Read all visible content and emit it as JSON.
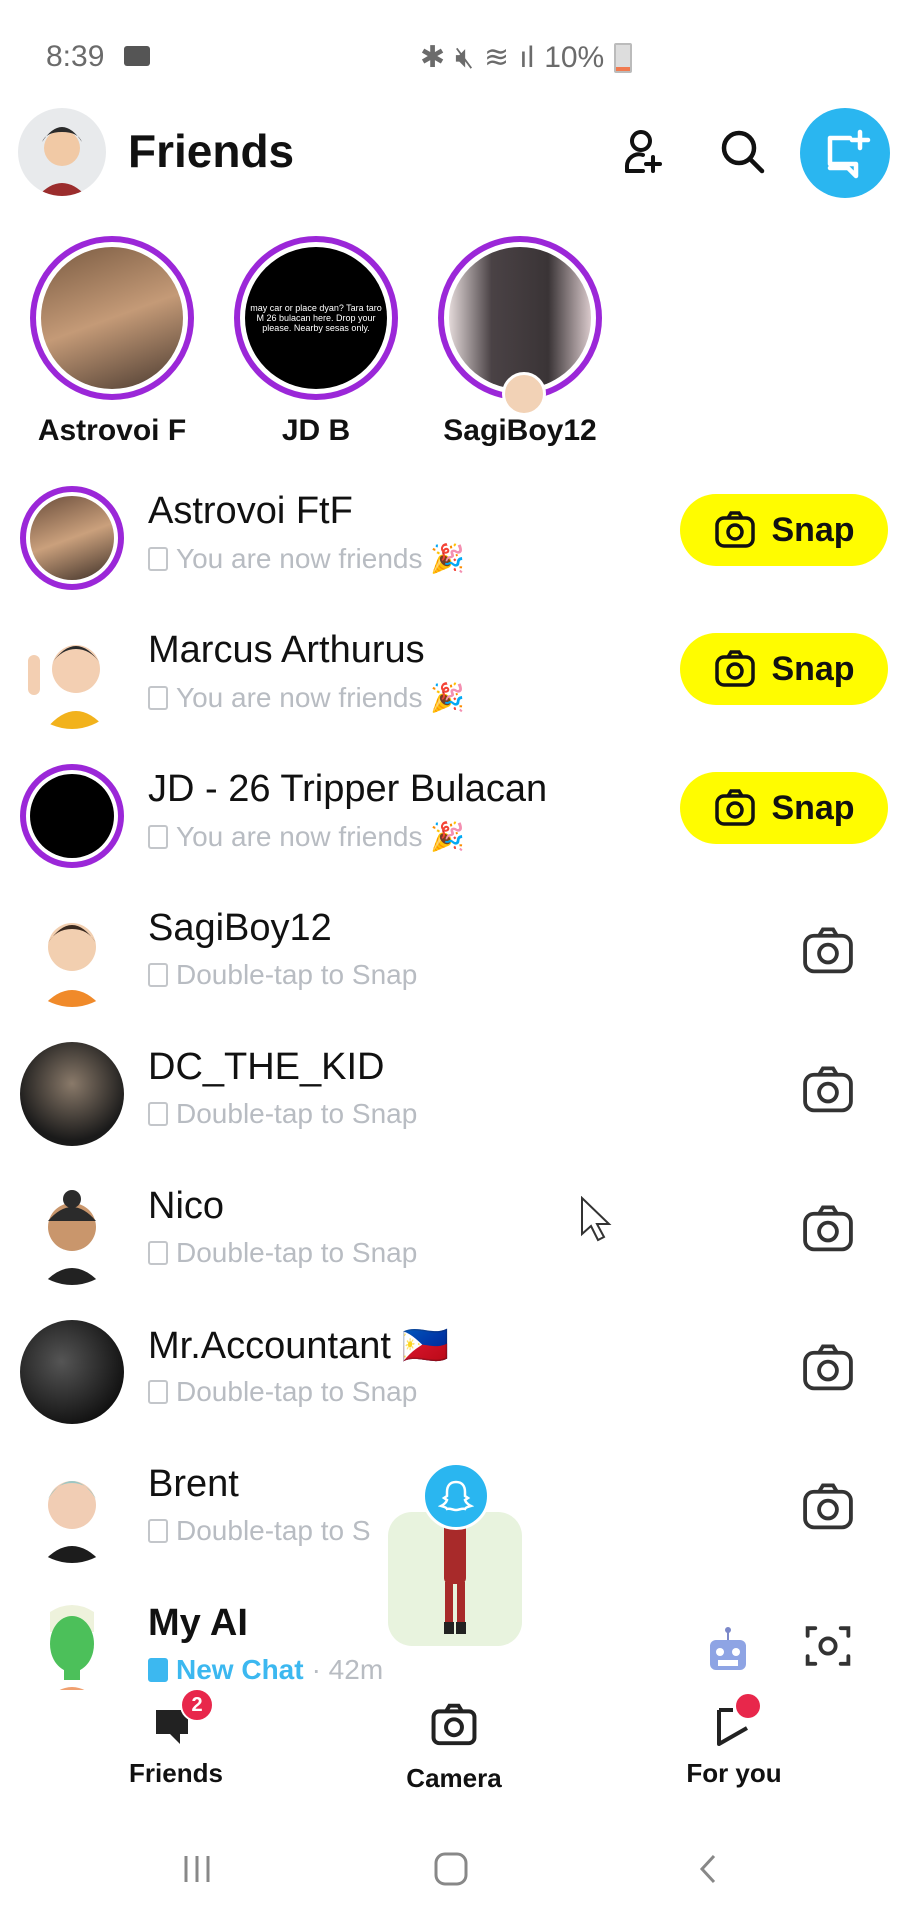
{
  "status_bar": {
    "time": "8:39",
    "battery": "10%"
  },
  "header": {
    "title": "Friends",
    "add_friend_icon": "add-friend-icon",
    "search_icon": "search-icon",
    "new_chat_icon": "new-chat-icon"
  },
  "stories": [
    {
      "name": "Astrovoi F",
      "thumb": "photo"
    },
    {
      "name": "JD B",
      "thumb": "text-black",
      "thumb_text": "may car or place dyan? Tara taro M 26 bulacan here. Drop your please. Nearby sesas only."
    },
    {
      "name": "SagiBoy12",
      "thumb": "photo-phone"
    }
  ],
  "friends": [
    {
      "name": "Astrovoi FtF",
      "status": "You are now friends 🎉",
      "action": "Snap",
      "story_ring": true
    },
    {
      "name": "Marcus Arthurus",
      "status": "You are now friends 🎉",
      "action": "Snap",
      "story_ring": false
    },
    {
      "name": "JD - 26 Tripper Bulacan",
      "status": "You are now friends 🎉",
      "action": "Snap",
      "story_ring": true
    },
    {
      "name": "SagiBoy12",
      "status": "Double-tap to Snap",
      "action": "camera"
    },
    {
      "name": "DC_THE_KID",
      "status": "Double-tap to Snap",
      "action": "camera"
    },
    {
      "name": "Nico",
      "status": "Double-tap to Snap",
      "action": "camera"
    },
    {
      "name": "Mr.Accountant 🇵🇭",
      "status": "Double-tap to Snap",
      "action": "camera"
    },
    {
      "name": "Brent",
      "status": "Double-tap to S",
      "action": "camera"
    },
    {
      "name": "My AI",
      "status": "New Chat",
      "time": "· 42m",
      "action": "scan"
    }
  ],
  "bottom_nav": {
    "friends": {
      "label": "Friends",
      "badge": "2"
    },
    "camera": {
      "label": "Camera"
    },
    "for_you": {
      "label": "For you"
    }
  },
  "colors": {
    "story_ring": "#9b27d8",
    "snap_yellow": "#fffc00",
    "accent_blue": "#2ab6f0",
    "badge_red": "#e8274b"
  }
}
